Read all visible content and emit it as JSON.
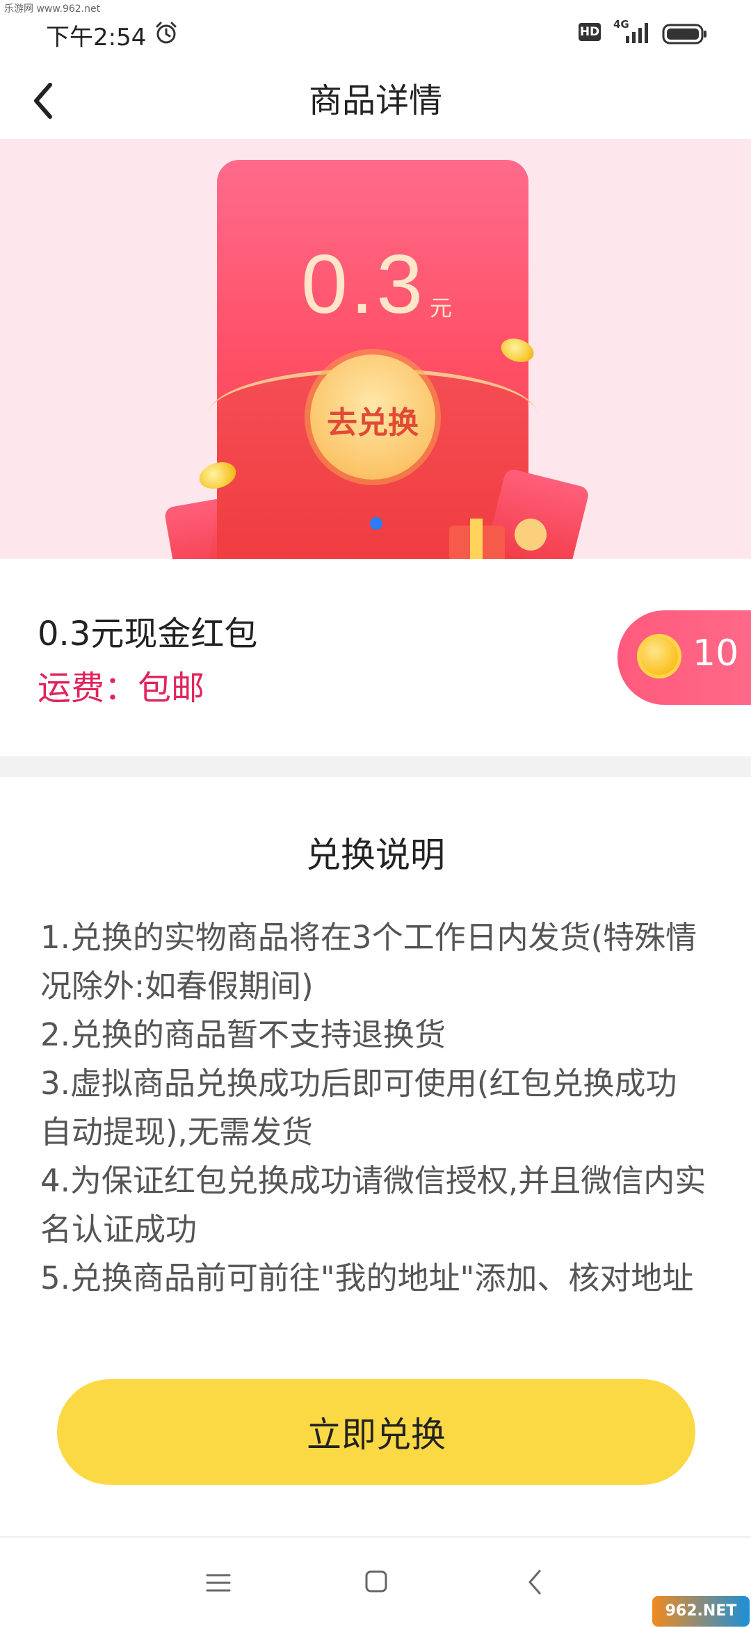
{
  "status_bar": {
    "watermark": "乐游网 www.962.net",
    "time": "下午2:54",
    "hd_label": "HD",
    "network_label": "4G"
  },
  "header": {
    "title": "商品详情"
  },
  "banner": {
    "amount": "0.3",
    "unit": "元",
    "redeem_label": "去兑换",
    "carousel_active_index": 1,
    "carousel_count": 1
  },
  "product": {
    "name": "0.3元现金红包",
    "shipping": "运费：包邮",
    "price": "10"
  },
  "notes": {
    "title": "兑换说明",
    "items": [
      "1.兑换的实物商品将在3个工作日内发货(特殊情况除外:如春假期间)",
      "2.兑换的商品暂不支持退换货",
      "3.虚拟商品兑换成功后即可使用(红包兑换成功自动提现),无需发货",
      "4.为保证红包兑换成功请微信授权,并且微信内实名认证成功",
      "5.兑换商品前可前往\"我的地址\"添加、核对地址"
    ]
  },
  "actions": {
    "redeem_now": "立即兑换"
  },
  "watermark_bottom": "962.NET",
  "colors": {
    "accent_pink": "#e0245c",
    "button_yellow": "#fbd944",
    "banner_bg": "#fde7ec",
    "carousel_dot": "#2c7cf6"
  },
  "icons": [
    "alarm-icon",
    "signal-icon",
    "battery-icon",
    "back-arrow-icon",
    "coin-icon",
    "menu-icon",
    "home-icon",
    "nav-back-icon"
  ]
}
